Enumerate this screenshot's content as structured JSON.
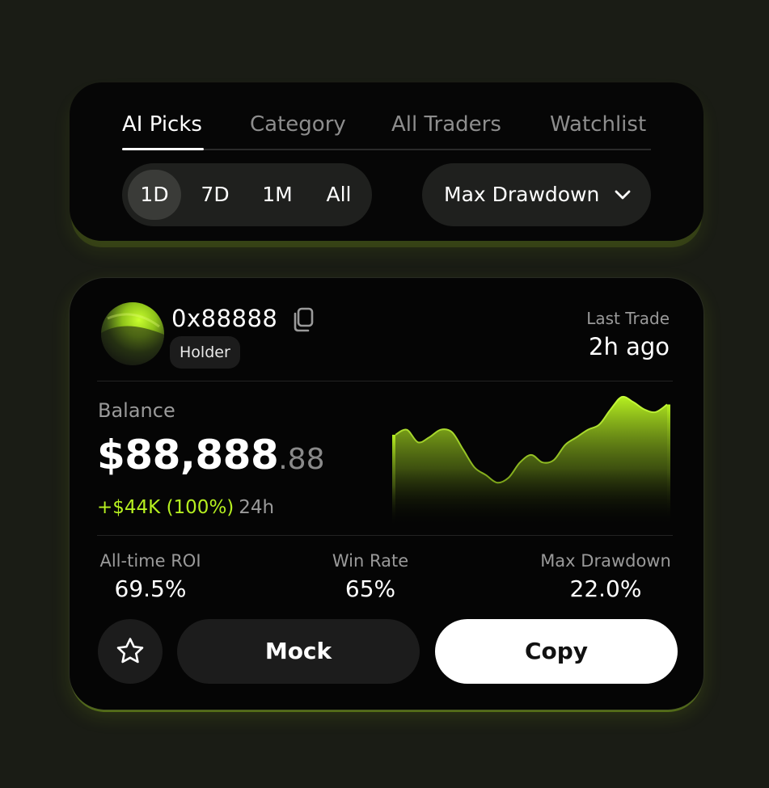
{
  "filters": {
    "tabs": [
      {
        "label": "AI Picks",
        "active": true
      },
      {
        "label": "Category",
        "active": false
      },
      {
        "label": "All Traders",
        "active": false
      },
      {
        "label": "Watchlist",
        "active": false
      }
    ],
    "periods": [
      {
        "label": "1D",
        "active": true
      },
      {
        "label": "7D",
        "active": false
      },
      {
        "label": "1M",
        "active": false
      },
      {
        "label": "All",
        "active": false
      }
    ],
    "sort": {
      "label": "Max Drawdown",
      "icon": "chevron-down-icon"
    }
  },
  "trader": {
    "address": "0x88888",
    "badge": "Holder",
    "last_trade_label": "Last Trade",
    "last_trade_value": "2h ago",
    "balance_label": "Balance",
    "balance_main": "$88,888",
    "balance_cents": ".88",
    "change_amount": "+$44K (100%)",
    "change_period": "24h",
    "stats": [
      {
        "label": "All-time ROI",
        "value": "69.5%"
      },
      {
        "label": "Win Rate",
        "value": "65%"
      },
      {
        "label": "Max Drawdown",
        "value": "22.0%"
      }
    ],
    "actions": {
      "favorite_icon": "star-icon",
      "mock_label": "Mock",
      "copy_label": "Copy"
    }
  },
  "chart_data": {
    "type": "area",
    "y": [
      0.68,
      0.72,
      0.62,
      0.66,
      0.72,
      0.7,
      0.56,
      0.42,
      0.36,
      0.3,
      0.34,
      0.46,
      0.52,
      0.46,
      0.48,
      0.6,
      0.66,
      0.72,
      0.76,
      0.88,
      0.98,
      0.94,
      0.88,
      0.86,
      0.92
    ],
    "grid": false,
    "colors": {
      "accent": "#b6f020",
      "positive": "#b6f020"
    }
  }
}
